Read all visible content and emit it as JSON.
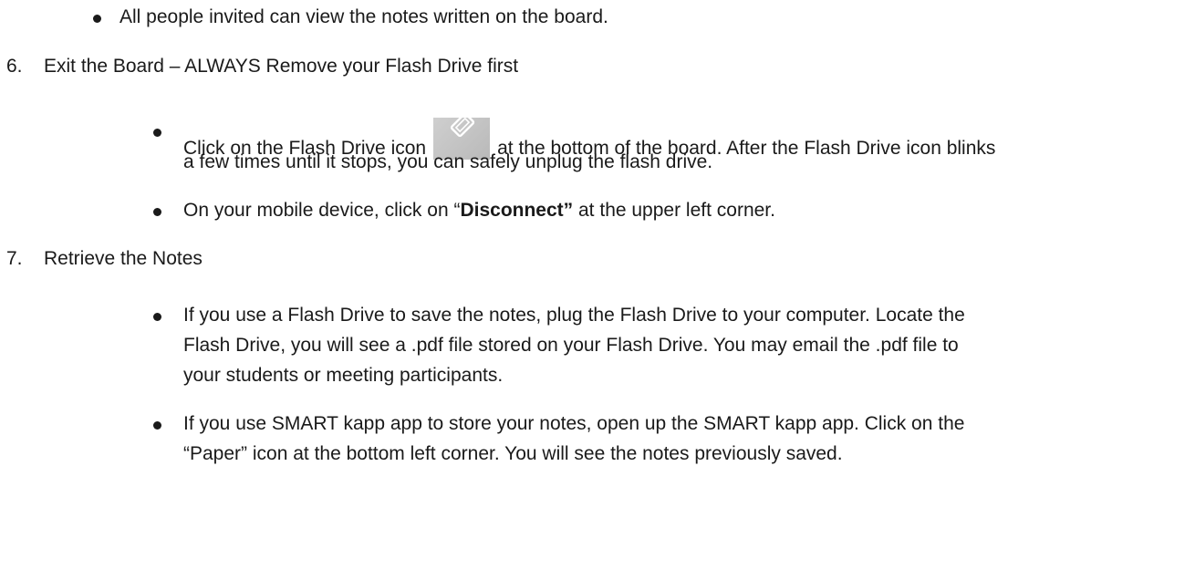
{
  "doc": {
    "b1": "All people invited can view the notes written on the board.",
    "s6": {
      "num": "6.",
      "title": "Exit the Board – ALWAYS Remove your Flash Drive first",
      "bullet1": {
        "before_icon": "Click on the Flash Drive icon",
        "after_icon": "at the bottom of the board.  After the  Flash Drive icon blinks",
        "line2": "a few times until it stops, you can safely unplug the flash drive."
      },
      "bullet2": {
        "before": "On your mobile device, click on “",
        "bold": "Disconnect”",
        "after": " at the upper left corner."
      }
    },
    "s7": {
      "num": "7.",
      "title": "Retrieve the Notes",
      "bullet1": {
        "line1": "If you use a Flash Drive to save the notes, plug the Flash Drive to your computer.  Locate the",
        "line2": "Flash Drive, you will see a .pdf file stored on your Flash Drive.  You may email the .pdf file to",
        "line3": "your students or meeting participants."
      },
      "bullet2": {
        "line1": "If you use SMART kapp app to store your notes, open up the SMART kapp app.  Click on the",
        "line2": "“Paper” icon at the bottom left corner. You will see the notes previously saved."
      }
    }
  },
  "icons": {
    "flash_drive": "usb-flash-drive-icon"
  }
}
